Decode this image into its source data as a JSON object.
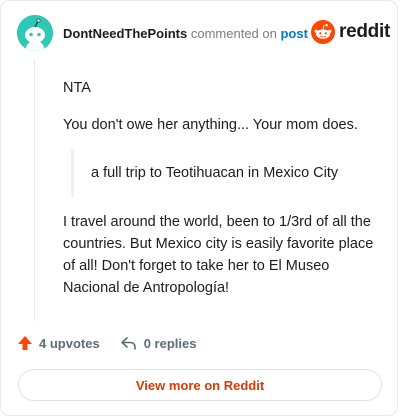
{
  "header": {
    "author": "DontNeedThePoints",
    "action_text": "commented on",
    "post_link": "post",
    "brand": "reddit"
  },
  "comment": {
    "paragraph1": "NTA",
    "paragraph2": "You don't owe her anything... Your mom does.",
    "quote": "a full trip to Teotihuacan in Mexico City",
    "paragraph3": "I travel around the world, been to 1/3rd of all the countries. But Mexico city is easily favorite place of all! Don't forget to take her to El Museo Nacional de Antropología!"
  },
  "actions": {
    "upvotes": "4 upvotes",
    "replies": "0 replies"
  },
  "footer": {
    "view_more": "View more on Reddit"
  },
  "colors": {
    "accent_orange": "#ff4500",
    "link_blue": "#0079d3",
    "avatar_teal": "#2fc7b5",
    "view_more_text": "#d93a00"
  },
  "icons": {
    "avatar": "snoo-avatar-icon",
    "logo": "reddit-snoo-icon",
    "upvote": "upvote-arrow-icon",
    "reply": "reply-arrow-icon"
  }
}
